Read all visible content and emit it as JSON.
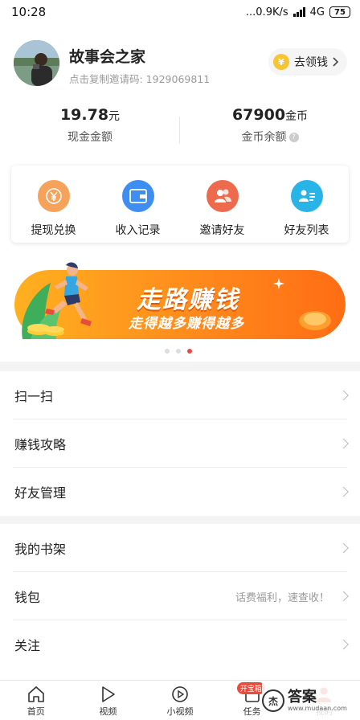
{
  "status_bar": {
    "time": "10:28",
    "network": "...0.9K/s",
    "carrier": "4G",
    "battery": "75"
  },
  "profile": {
    "name": "故事会之家",
    "invite_text": "点击复制邀请码: 1929069811",
    "claim_label": "去领钱",
    "claim_icon": "yen-coin-icon"
  },
  "stats": {
    "cash": {
      "value": "19.78",
      "unit": "元",
      "label": "现金金额"
    },
    "coins": {
      "value": "67900",
      "unit": "金币",
      "label": "金币余额",
      "help_icon": "question-icon"
    }
  },
  "quick_actions": [
    {
      "label": "提现兑换",
      "icon": "yen-icon",
      "color": "#f5a25a"
    },
    {
      "label": "收入记录",
      "icon": "wallet-icon",
      "color": "#3d8ef0"
    },
    {
      "label": "邀请好友",
      "icon": "users-icon",
      "color": "#ee6a4d"
    },
    {
      "label": "好友列表",
      "icon": "contact-list-icon",
      "color": "#29b4e8"
    }
  ],
  "banner": {
    "title": "走路赚钱",
    "subtitle": "走得越多赚得越多",
    "active_dot": 2
  },
  "menu_group_1": [
    {
      "label": "扫一扫"
    },
    {
      "label": "赚钱攻略"
    },
    {
      "label": "好友管理"
    }
  ],
  "menu_group_2": [
    {
      "label": "我的书架",
      "hint": ""
    },
    {
      "label": "钱包",
      "hint": "话费福利，速查收！"
    },
    {
      "label": "关注",
      "hint": ""
    }
  ],
  "tabbar": [
    {
      "label": "首页",
      "icon": "home-icon"
    },
    {
      "label": "视频",
      "icon": "play-icon"
    },
    {
      "label": "小视频",
      "icon": "short-video-icon"
    },
    {
      "label": "任务",
      "icon": "task-icon",
      "badge": "开宝箱"
    },
    {
      "label": "我的",
      "icon": "profile-icon"
    }
  ],
  "watermark": {
    "text": "答案",
    "url": "www.mudaan.com"
  }
}
